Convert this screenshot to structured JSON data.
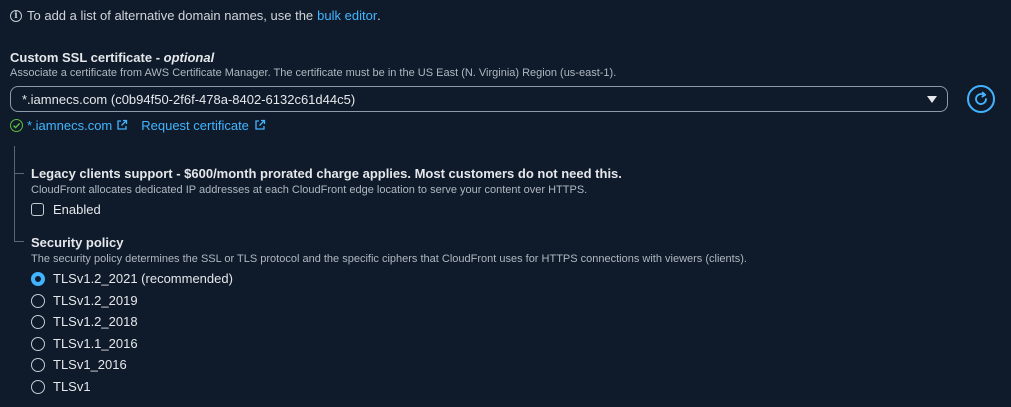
{
  "info": {
    "text": "To add a list of alternative domain names, use the",
    "link": "bulk editor",
    "suffix": "."
  },
  "ssl": {
    "label": "Custom SSL certificate - ",
    "optional": "optional",
    "description": "Associate a certificate from AWS Certificate Manager. The certificate must be in the US East (N. Virginia) Region (us-east-1).",
    "selected_value": "*.iamnecs.com (c0b94f50-2f6f-478a-8402-6132c61d44c5)",
    "cert_link": "*.iamnecs.com",
    "request_link": "Request certificate"
  },
  "legacy": {
    "label": "Legacy clients support - $600/month prorated charge applies. Most customers do not need this.",
    "description": "CloudFront allocates dedicated IP addresses at each CloudFront edge location to serve your content over HTTPS.",
    "checkbox_label": "Enabled",
    "checked": false
  },
  "security_policy": {
    "label": "Security policy",
    "description": "The security policy determines the SSL or TLS protocol and the specific ciphers that CloudFront uses for HTTPS connections with viewers (clients).",
    "options": [
      {
        "label": "TLSv1.2_2021 (recommended)",
        "selected": true
      },
      {
        "label": "TLSv1.2_2019",
        "selected": false
      },
      {
        "label": "TLSv1.2_2018",
        "selected": false
      },
      {
        "label": "TLSv1.1_2016",
        "selected": false
      },
      {
        "label": "TLSv1_2016",
        "selected": false
      },
      {
        "label": "TLSv1",
        "selected": false
      }
    ]
  },
  "colors": {
    "background": "#0f1b2a",
    "link": "#42b4ff",
    "success": "#5fbf3f"
  },
  "icons": [
    "info-icon",
    "caret-down-icon",
    "refresh-icon",
    "check-circle-icon",
    "external-link-icon"
  ]
}
